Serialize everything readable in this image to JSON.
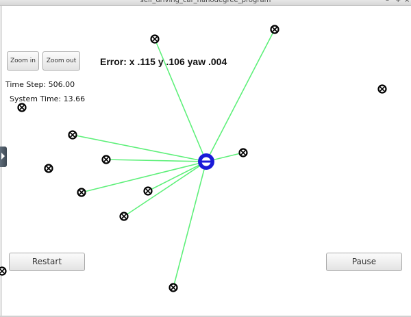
{
  "window": {
    "title": "self_driving_car_nanodegree_program",
    "controls": [
      "–",
      "+",
      "×"
    ]
  },
  "toolbar": {
    "zoom_in_label": "Zoom in",
    "zoom_out_label": "Zoom out"
  },
  "status": {
    "error_text": "Error: x .115 y .106 yaw .004",
    "time_step": "Time Step: 506.00",
    "system_time": "System Time: 13.66"
  },
  "buttons": {
    "restart_label": "Restart",
    "pause_label": "Pause"
  },
  "colors": {
    "ray": "#5ef07a",
    "car": "#1a1ad8",
    "landmark": "#000000"
  },
  "icons": [
    "landmark-marker-icon",
    "vehicle-icon",
    "panel-toggle-icon"
  ]
}
